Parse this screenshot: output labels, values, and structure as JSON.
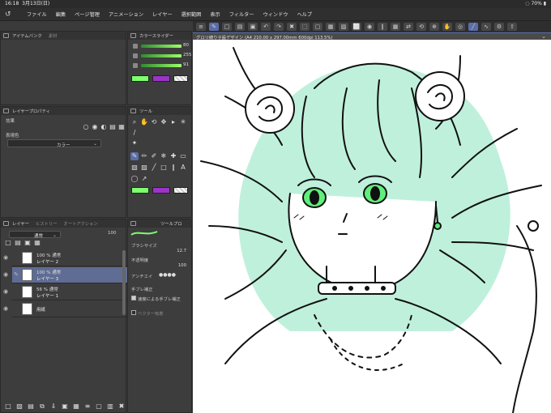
{
  "status": {
    "time": "16:18",
    "date": "3月13日(日)",
    "battery": "70%"
  },
  "menu": [
    "ファイル",
    "編集",
    "ページ管理",
    "アニメーション",
    "レイヤー",
    "選択範囲",
    "表示",
    "フィルター",
    "ウィンドウ",
    "ヘルプ"
  ],
  "canvas_tab": {
    "title": "グロリ綺り子設デザイン (A4 210.00 x 297.00mm 600dpi 113.5%)"
  },
  "panels": {
    "asset": {
      "title": "アイテムバンク",
      "title2": "素材"
    },
    "color": {
      "title": "カラースライダー",
      "r": "80",
      "g": "255",
      "b": "91",
      "main_color": "#7dff6e",
      "sub_color": "#9b34c8"
    },
    "layer_prop": {
      "title": "レイヤープロパティ",
      "effect_label": "効果",
      "expression_label": "表現色",
      "expression_value": "カラー"
    },
    "tool": {
      "title": "ツール"
    },
    "layer": {
      "tabs": [
        "レイヤー",
        "ヒストリー",
        "オートアクション"
      ],
      "blend": "通常",
      "opacity": "100",
      "layers": [
        {
          "mode": "100 % 通常",
          "name": "レイヤー 2",
          "selected": false
        },
        {
          "mode": "100 % 通常",
          "name": "レイヤー 3",
          "selected": true
        },
        {
          "mode": "56 % 通常",
          "name": "レイヤー 1",
          "selected": false
        },
        {
          "mode": "",
          "name": "用紙",
          "selected": false
        }
      ]
    },
    "tool_prop": {
      "title": "ツールプロ",
      "brush_size_label": "ブラシサイズ",
      "brush_size": "12.7",
      "opacity_label": "不透明度",
      "opacity": "100",
      "antialias_label": "アンチエイ",
      "stabilization_label": "手ブレ補正",
      "speed_stab_label": "速度による手ブレ補正",
      "vector_label": "ベクター吸着"
    }
  }
}
